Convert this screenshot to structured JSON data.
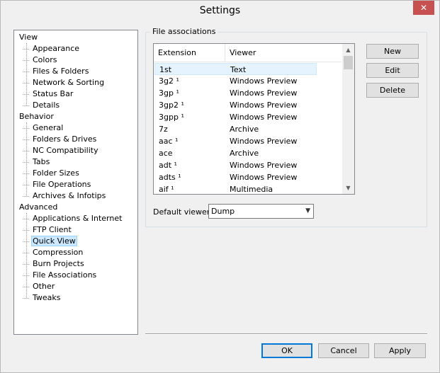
{
  "window": {
    "title": "Settings",
    "close_glyph": "✕"
  },
  "tree": {
    "groups": [
      {
        "label": "View",
        "items": [
          "Appearance",
          "Colors",
          "Files & Folders",
          "Network & Sorting",
          "Status Bar",
          "Details"
        ]
      },
      {
        "label": "Behavior",
        "items": [
          "General",
          "Folders & Drives",
          "NC Compatibility",
          "Tabs",
          "Folder Sizes",
          "File Operations",
          "Archives & Infotips"
        ]
      },
      {
        "label": "Advanced",
        "items": [
          "Applications & Internet",
          "FTP Client",
          "Quick View",
          "Compression",
          "Burn Projects",
          "File Associations",
          "Other",
          "Tweaks"
        ]
      }
    ],
    "selected": "Quick View"
  },
  "file_associations": {
    "group_label": "File associations",
    "columns": {
      "extension": "Extension",
      "viewer": "Viewer"
    },
    "rows": [
      {
        "ext": "1st",
        "viewer": "Text"
      },
      {
        "ext": "3g2 ¹",
        "viewer": "Windows Preview"
      },
      {
        "ext": "3gp ¹",
        "viewer": "Windows Preview"
      },
      {
        "ext": "3gp2 ¹",
        "viewer": "Windows Preview"
      },
      {
        "ext": "3gpp ¹",
        "viewer": "Windows Preview"
      },
      {
        "ext": "7z",
        "viewer": "Archive"
      },
      {
        "ext": "aac ¹",
        "viewer": "Windows Preview"
      },
      {
        "ext": "ace",
        "viewer": "Archive"
      },
      {
        "ext": "adt ¹",
        "viewer": "Windows Preview"
      },
      {
        "ext": "adts ¹",
        "viewer": "Windows Preview"
      },
      {
        "ext": "aif ¹",
        "viewer": "Multimedia"
      }
    ],
    "buttons": {
      "new": "New",
      "edit": "Edit",
      "delete": "Delete"
    },
    "default_viewer": {
      "label": "Default viewer:",
      "value": "Dump"
    }
  },
  "footer": {
    "ok": "OK",
    "cancel": "Cancel",
    "apply": "Apply"
  },
  "icons": {
    "scroll_up": "▲",
    "scroll_down": "▼",
    "dropdown": "▼"
  }
}
